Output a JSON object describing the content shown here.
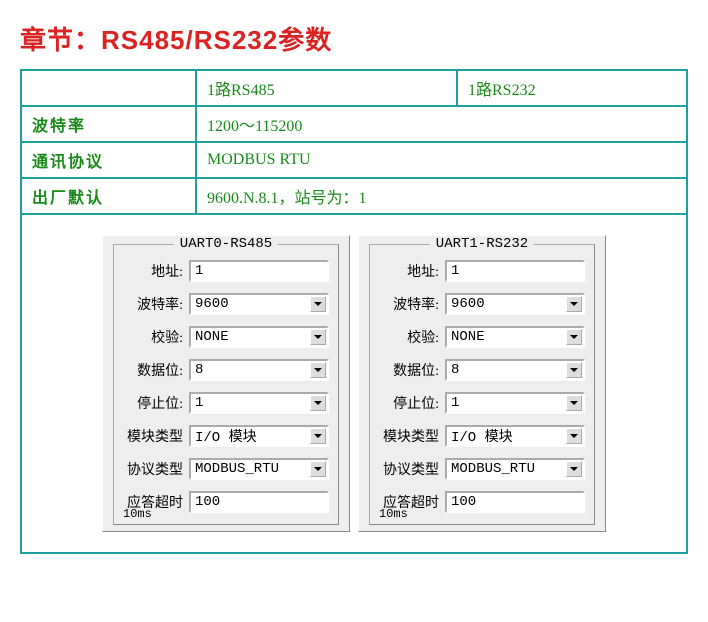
{
  "title": "章节：RS485/RS232参数",
  "table": {
    "r0c1": "1路RS485",
    "r0c2": "1路RS232",
    "r1label": "波特率",
    "r1val": "1200～115200",
    "r2label": "通讯协议",
    "r2val": "MODBUS RTU",
    "r3label": "出厂默认",
    "r3val": "9600.N.8.1，站号为：1"
  },
  "panel0": {
    "legend": "UART0-RS485",
    "addr_label": "地址:",
    "addr_val": "1",
    "baud_label": "波特率:",
    "baud_val": "9600",
    "parity_label": "校验:",
    "parity_val": "NONE",
    "databits_label": "数据位:",
    "databits_val": "8",
    "stopbits_label": "停止位:",
    "stopbits_val": "1",
    "modtype_label": "模块类型",
    "modtype_val": "I/O 模块",
    "prototype_label": "协议类型",
    "prototype_val": "MODBUS_RTU",
    "timeout_label": "应答超时",
    "timeout_val": "100",
    "timeout_unit": "10ms"
  },
  "panel1": {
    "legend": "UART1-RS232",
    "addr_label": "地址:",
    "addr_val": "1",
    "baud_label": "波特率:",
    "baud_val": "9600",
    "parity_label": "校验:",
    "parity_val": "NONE",
    "databits_label": "数据位:",
    "databits_val": "8",
    "stopbits_label": "停止位:",
    "stopbits_val": "1",
    "modtype_label": "模块类型",
    "modtype_val": "I/O 模块",
    "prototype_label": "协议类型",
    "prototype_val": "MODBUS_RTU",
    "timeout_label": "应答超时",
    "timeout_val": "100",
    "timeout_unit": "10ms"
  }
}
